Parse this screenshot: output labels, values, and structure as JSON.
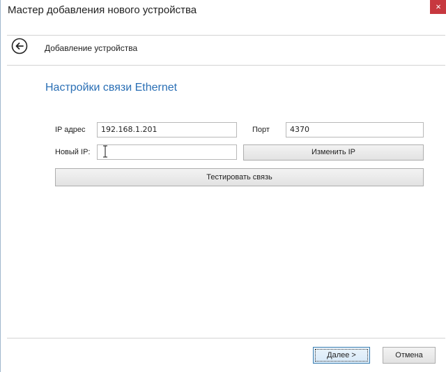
{
  "window": {
    "title": "Мастер добавления нового устройства",
    "close_label": "×"
  },
  "header": {
    "back_icon": "back-arrow-icon",
    "title": "Добавление устройства"
  },
  "section": {
    "title": "Настройки связи Ethernet"
  },
  "form": {
    "ip_label": "IP адрес",
    "ip_value": "192.168.1.201",
    "port_label": "Порт",
    "port_value": "4370",
    "new_ip_label": "Новый IP:",
    "new_ip_value": "",
    "change_ip_button": "Изменить IP",
    "test_button": "Тестировать связь"
  },
  "footer": {
    "next_button": "Далее >",
    "cancel_button": "Отмена"
  },
  "colors": {
    "accent": "#2a6fb5",
    "close_button": "#c7383f"
  }
}
